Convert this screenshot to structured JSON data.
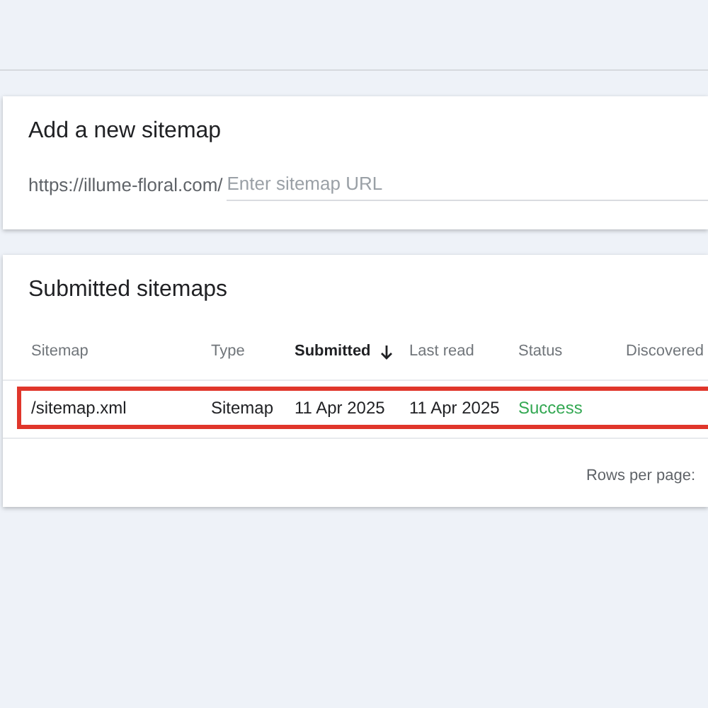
{
  "add_sitemap": {
    "title": "Add a new sitemap",
    "prefix": "https://illume-floral.com/",
    "placeholder": "Enter sitemap URL"
  },
  "submitted": {
    "title": "Submitted sitemaps",
    "columns": [
      {
        "label": "Sitemap",
        "sorted": false
      },
      {
        "label": "Type",
        "sorted": false
      },
      {
        "label": "Submitted",
        "sorted": true
      },
      {
        "label": "Last read",
        "sorted": false
      },
      {
        "label": "Status",
        "sorted": false
      },
      {
        "label": "Discovered",
        "sorted": false
      }
    ],
    "rows": [
      {
        "highlighted": true,
        "cells": [
          "/sitemap.xml",
          "Sitemap",
          "11 Apr 2025",
          "11 Apr 2025",
          "Success"
        ],
        "color": "#34a853"
      }
    ],
    "footer": {
      "rows_per_page": "Rows per page:"
    }
  }
}
